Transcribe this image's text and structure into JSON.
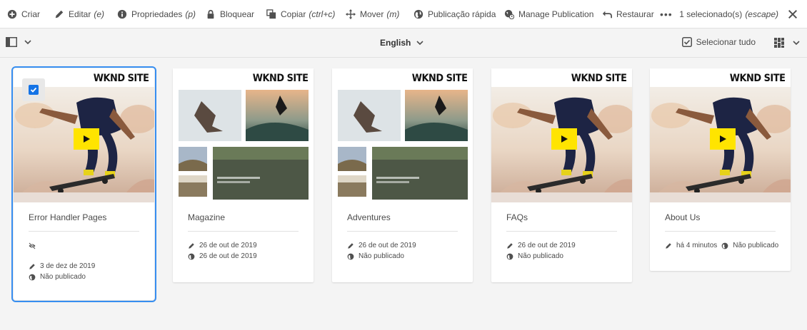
{
  "toolbar": {
    "create": {
      "label": "Criar",
      "icon": "add-circle-icon"
    },
    "edit": {
      "label": "Editar",
      "hint": "(e)",
      "icon": "pencil-icon"
    },
    "properties": {
      "label": "Propriedades",
      "hint": "(p)",
      "icon": "info-icon"
    },
    "lock": {
      "label": "Bloquear",
      "icon": "lock-icon"
    },
    "copy": {
      "label": "Copiar",
      "hint": "(ctrl+c)",
      "icon": "copy-icon"
    },
    "move": {
      "label": "Mover",
      "hint": "(m)",
      "icon": "move-icon"
    },
    "quick_publish": {
      "label": "Publicação rápida",
      "icon": "globe-icon"
    },
    "manage_publication": {
      "label": "Manage Publication",
      "icon": "globe-clock-icon"
    },
    "restore": {
      "label": "Restaurar",
      "icon": "undo-icon"
    },
    "more": "•••",
    "selection_status": "1 selecionado(s)",
    "selection_hint": "(escape)"
  },
  "subbar": {
    "language": "English",
    "select_all": "Selecionar tudo"
  },
  "brand_text": "WKND SITE",
  "colors": {
    "accent": "#378ef0",
    "checkbox": "#1473e6",
    "play": "#ffe400"
  },
  "cards": [
    {
      "title": "Error Handler Pages",
      "selected": true,
      "thumbnail": "skater-hero",
      "no_preview_icon": "eye-off-icon",
      "modified": "3 de dez de 2019",
      "published": "Não publicado"
    },
    {
      "title": "Magazine",
      "selected": false,
      "thumbnail": "skater-grid",
      "modified": "26 de out de 2019",
      "published": "26 de out de 2019"
    },
    {
      "title": "Adventures",
      "selected": false,
      "thumbnail": "skater-grid",
      "modified": "26 de out de 2019",
      "published": "Não publicado"
    },
    {
      "title": "FAQs",
      "selected": false,
      "thumbnail": "skater-hero",
      "modified": "26 de out de 2019",
      "published": "Não publicado"
    },
    {
      "title": "About Us",
      "selected": false,
      "thumbnail": "skater-hero",
      "modified": "há 4 minutos",
      "published": "Não publicado"
    }
  ]
}
